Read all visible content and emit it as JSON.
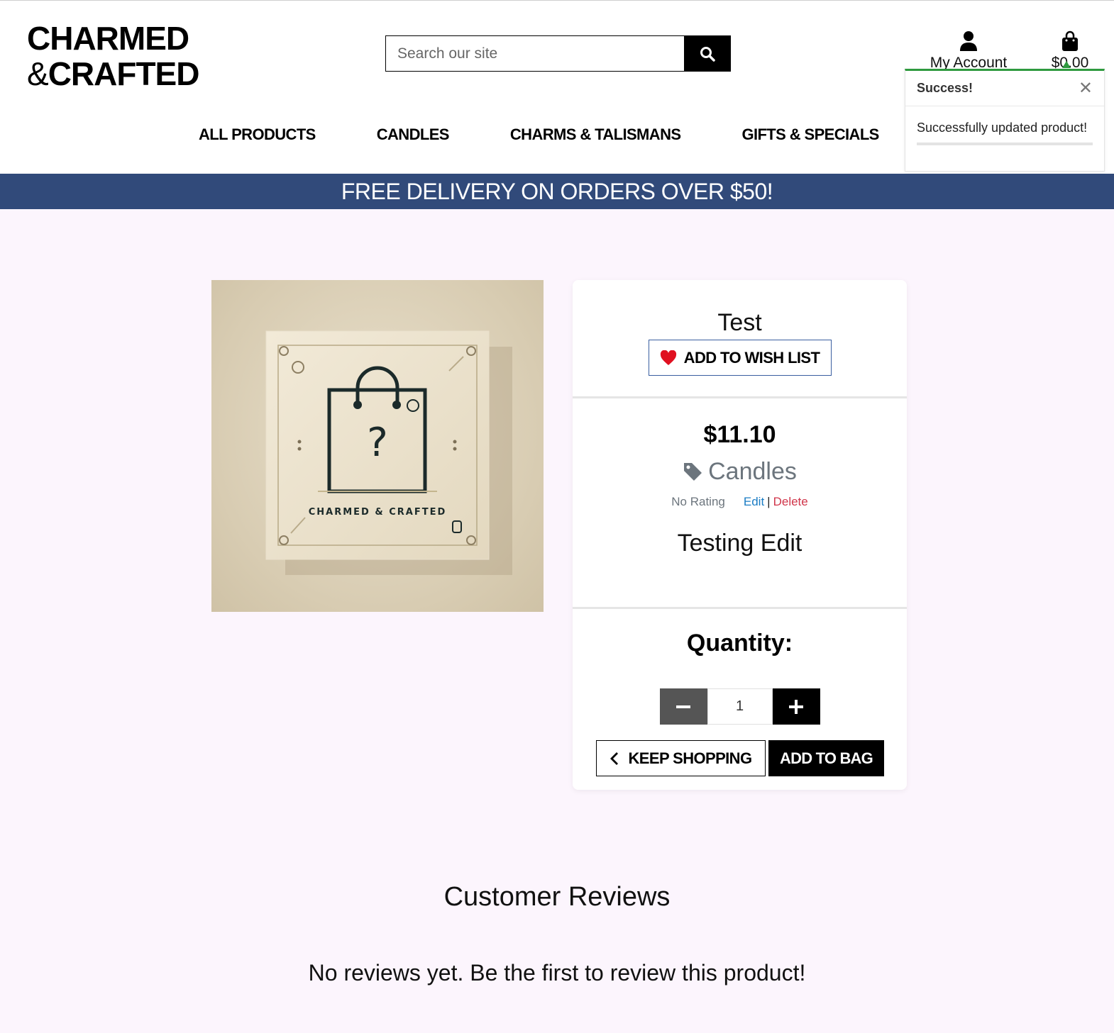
{
  "header": {
    "logo_line1": "CHARMED",
    "logo_amp": "&",
    "logo_line2": "CRAFTED",
    "search_placeholder": "Search our site",
    "search_icon": "magnifier-icon",
    "account_label": "My Account",
    "account_icon": "user-icon",
    "bag_total": "$0.00",
    "bag_icon": "shopping-bag-icon"
  },
  "nav": {
    "items": [
      {
        "label": "ALL PRODUCTS"
      },
      {
        "label": "CANDLES"
      },
      {
        "label": "CHARMS & TALISMANS"
      },
      {
        "label": "GIFTS & SPECIALS"
      }
    ]
  },
  "banner": {
    "text": "FREE DELIVERY ON ORDERS OVER $50!",
    "color": "#314a7a"
  },
  "toast": {
    "title": "Success!",
    "message": "Successfully updated product!",
    "close_icon": "close-icon",
    "accent": "#2e9a3e"
  },
  "product": {
    "image_brand_text": "CHARMED & CRAFTED",
    "name": "Test",
    "wishlist_label": "ADD TO WISH LIST",
    "wishlist_icon": "heart-icon",
    "price": "$11.10",
    "category": "Candles",
    "category_icon": "tag-icon",
    "rating": "No Rating",
    "edit_label": "Edit",
    "separator": "|",
    "delete_label": "Delete",
    "description": "Testing Edit",
    "quantity_label": "Quantity:",
    "quantity_value": "1",
    "keep_shopping_label": "KEEP SHOPPING",
    "add_to_bag_label": "ADD TO BAG"
  },
  "reviews": {
    "title": "Customer Reviews",
    "empty_text": "No reviews yet. Be the first to review this product!"
  }
}
